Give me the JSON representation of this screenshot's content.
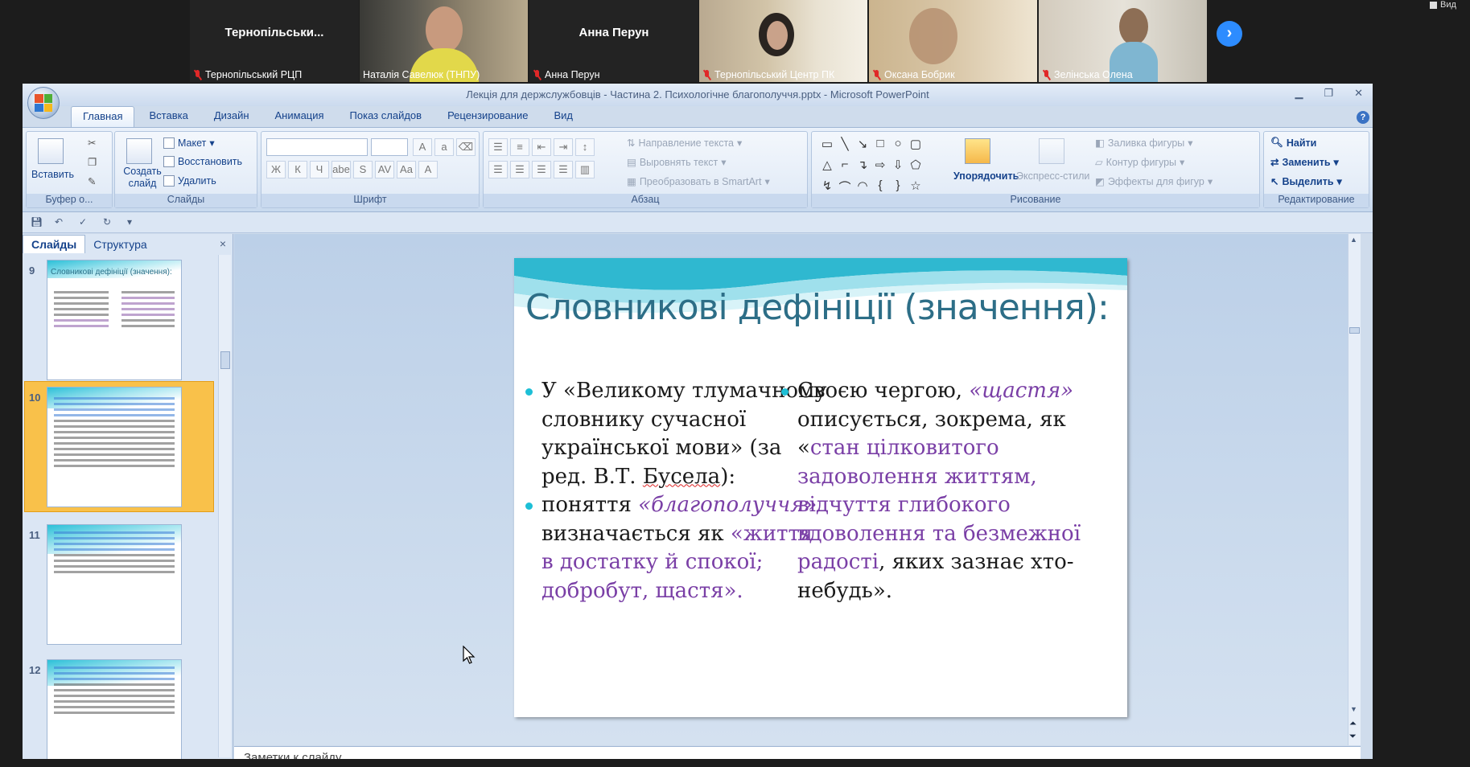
{
  "participants": [
    {
      "display": "Тернопільськи...",
      "label": "Тернопільський РЦП",
      "muted": true,
      "video": false
    },
    {
      "display": "",
      "label": "Наталія Савелюк (ТНПУ)",
      "muted": false,
      "video": true,
      "active": true
    },
    {
      "display": "Анна Перун",
      "label": "Анна Перун",
      "muted": true,
      "video": false
    },
    {
      "display": "",
      "label": "Тернопільський Центр ПК",
      "muted": true,
      "video": true
    },
    {
      "display": "",
      "label": "Оксана Бобрик",
      "muted": true,
      "video": true
    },
    {
      "display": "",
      "label": "Зелінська Олена",
      "muted": true,
      "video": true
    }
  ],
  "zoom": {
    "next_glyph": "›",
    "view_label": "Вид"
  },
  "window": {
    "title": "Лекція для держслужбовців - Частина 2. Психологічне благополуччя.pptx - Microsoft PowerPoint",
    "minimize": "▁",
    "restore": "❐",
    "close": "✕"
  },
  "ribbon_tabs": [
    "Главная",
    "Вставка",
    "Дизайн",
    "Анимация",
    "Показ слайдов",
    "Рецензирование",
    "Вид"
  ],
  "ribbon": {
    "clipboard": {
      "paste": "Вставить",
      "title": "Буфер о..."
    },
    "slides": {
      "create": "Создать слайд",
      "layout": "Макет",
      "reset": "Восстановить",
      "delete": "Удалить",
      "title": "Слайды"
    },
    "font": {
      "title": "Шрифт",
      "buttons": [
        "Ж",
        "К",
        "Ч",
        "abe",
        "S",
        "AV",
        "Aa",
        "A"
      ]
    },
    "paragraph": {
      "direction": "Направление текста",
      "align": "Выровнять текст",
      "smartart": "Преобразовать в SmartArt",
      "title": "Абзац"
    },
    "drawing": {
      "arrange": "Упорядочить",
      "styles": "Экспресс-стили",
      "fill": "Заливка фигуры",
      "outline": "Контур фигуры",
      "effects": "Эффекты для фигур",
      "title": "Рисование"
    },
    "editing": {
      "find": "Найти",
      "replace": "Заменить",
      "select": "Выделить",
      "title": "Редактирование"
    }
  },
  "pane": {
    "tab_slides": "Слайды",
    "tab_outline": "Структура",
    "close": "×"
  },
  "thumbnails": [
    {
      "num": "9",
      "title": "Словникові дефініції (значення):",
      "selected": false
    },
    {
      "num": "10",
      "title": "",
      "selected": true
    },
    {
      "num": "11",
      "title": "",
      "selected": false
    },
    {
      "num": "12",
      "title": "",
      "selected": false
    }
  ],
  "slide": {
    "title": "Словникові дефініції (значення):",
    "left": {
      "b1_pre": "У «Великому тлумачному словнику сучасної української мови» (за ред. В.Т. ",
      "b1_wavy": "Бусела",
      "b1_post": "):",
      "b2_pre": "поняття ",
      "b2_term": "«благополуччя»",
      "b2_mid": " визначається як ",
      "b2_def": "«життя в достатку й спокої; добробут, щастя»."
    },
    "right": {
      "pre": "Своєю чергою, ",
      "term": "«щастя»",
      "mid": " описується, зокрема, як «",
      "def": "стан цілковитого задоволення життям, відчуття глибокого вдоволення та безмежної радості",
      "post": ", яких зазнає хто-небудь»."
    }
  },
  "notes_placeholder": "Заметки к слайду",
  "colors": {
    "accent_teal": "#2d6e87",
    "bullet": "#1dbfd6",
    "purple": "#7a3fa6",
    "zoom_blue": "#2d8cff"
  }
}
